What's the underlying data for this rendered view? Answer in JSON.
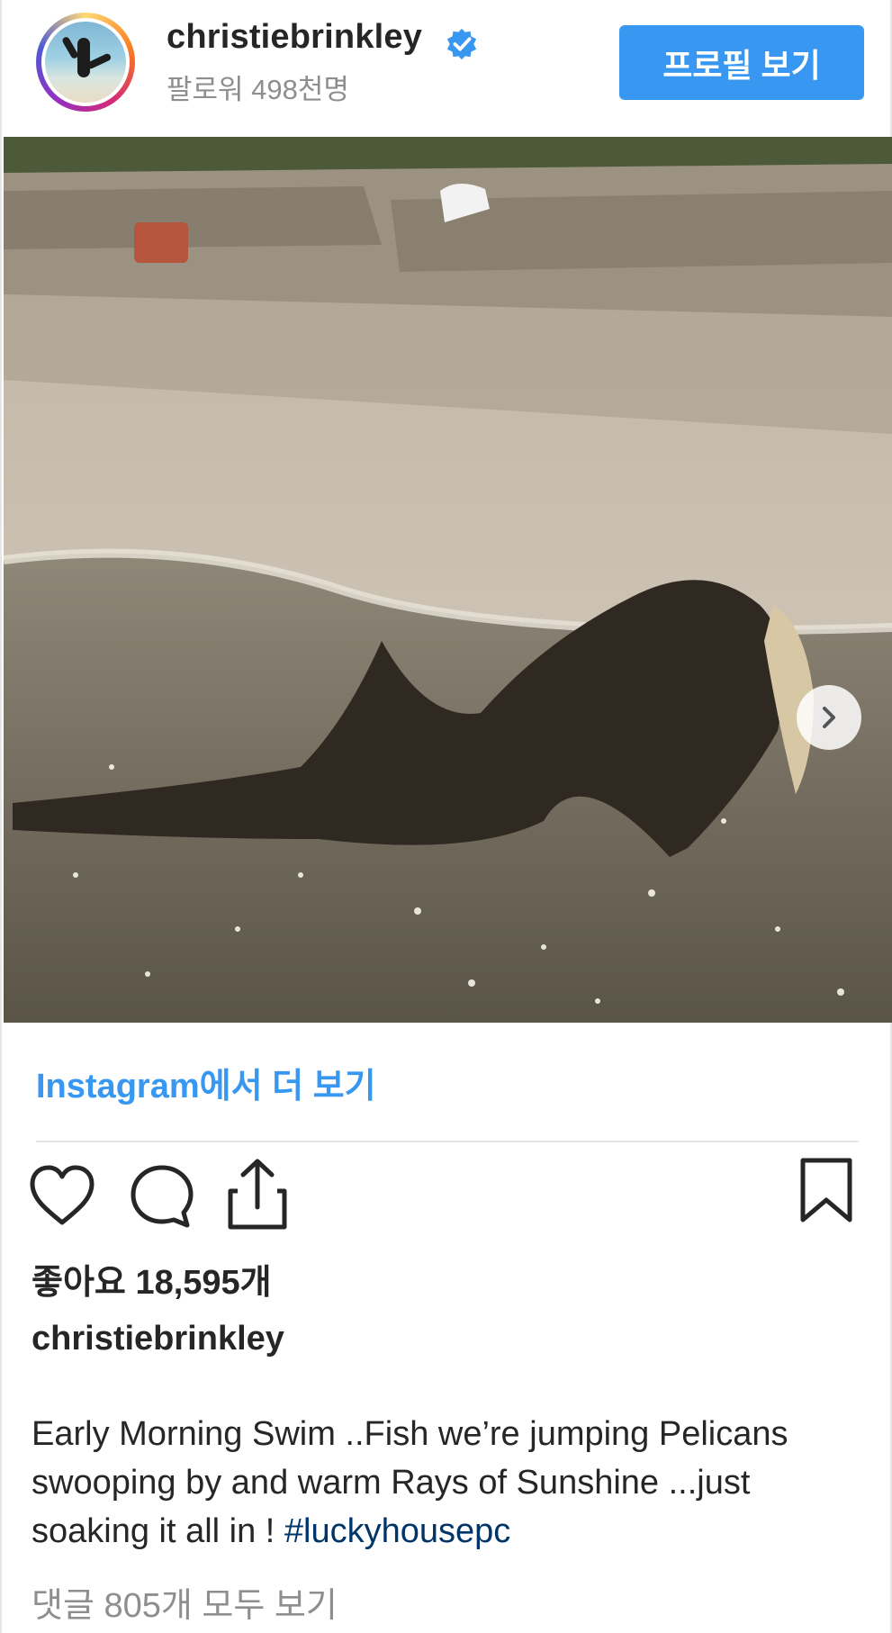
{
  "header": {
    "username": "christiebrinkley",
    "followers": "팔로워 498천명",
    "profile_button": "프로필 보기",
    "verified_icon": "verified-badge-icon"
  },
  "post": {
    "more_link": "Instagram에서 더 보기",
    "likes": "좋아요 18,595개",
    "caption_user": "christiebrinkley",
    "caption_text": "Early Morning Swim ..Fish we’re jumping Pelicans swooping by and warm Rays of Sunshine ...just soaking it all in ! ",
    "hashtag": "#luckyhousepc",
    "comments_link": "댓글 805개 모두 보기"
  },
  "icons": {
    "like": "heart-icon",
    "comment": "comment-bubble-icon",
    "share": "share-icon",
    "save": "bookmark-icon",
    "next": "chevron-right-icon"
  },
  "colors": {
    "accent": "#3897f0",
    "text": "#262626",
    "muted": "#8e8e8e",
    "hashtag": "#003569"
  }
}
